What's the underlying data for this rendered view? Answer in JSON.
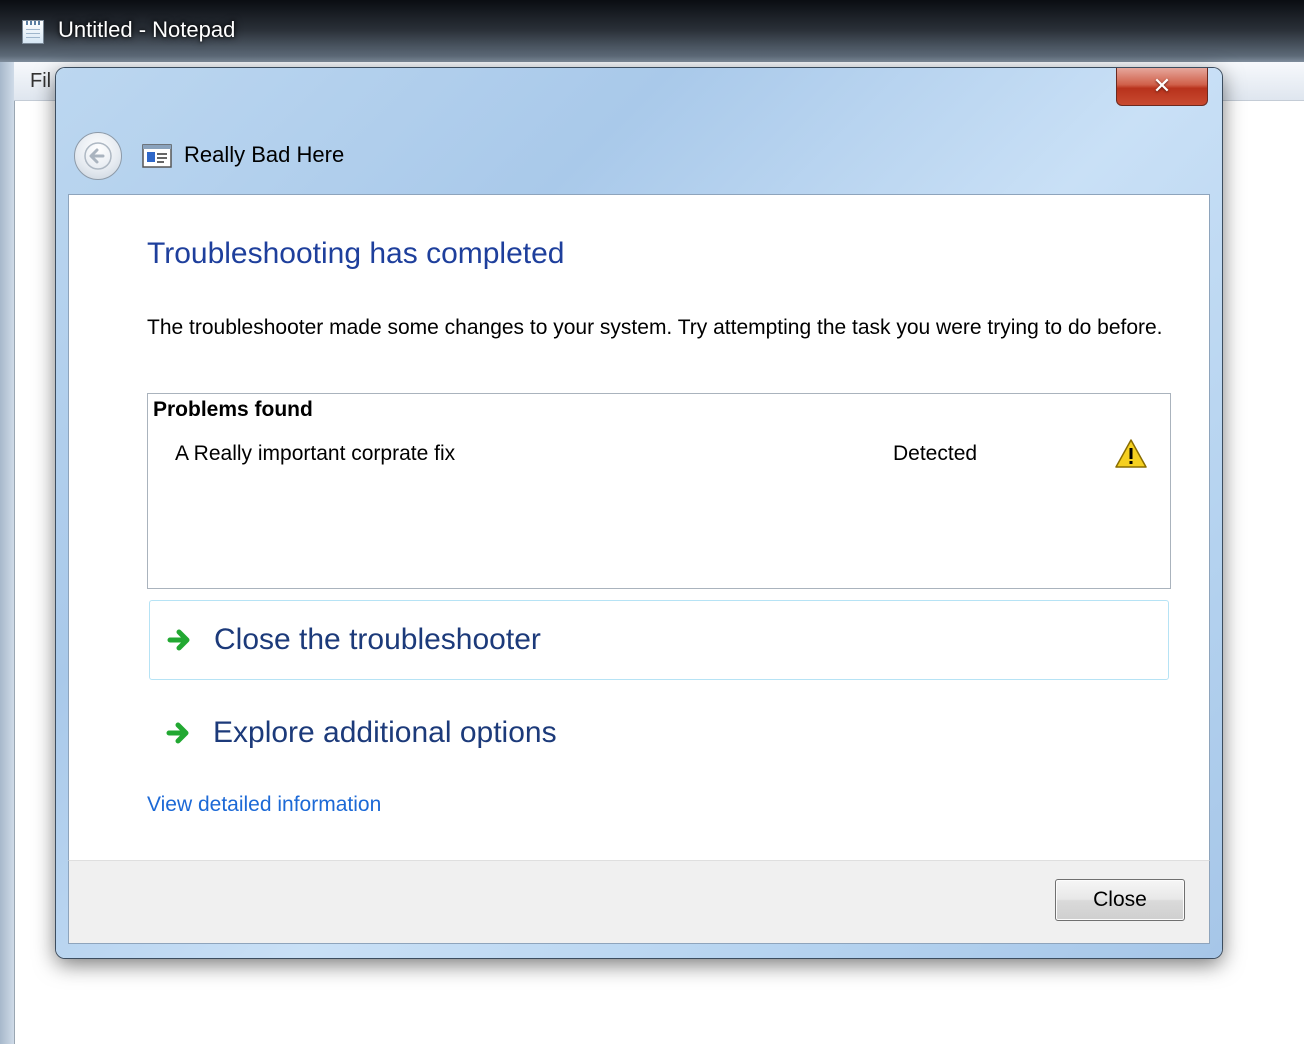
{
  "notepad": {
    "window_title": "Untitled - Notepad",
    "menu_first": "Fil",
    "icon": "notepad-icon"
  },
  "dialog": {
    "app_title": "Really Bad Here",
    "close_glyph": "✕",
    "icons": [
      "back-arrow-icon",
      "troubleshooter-app-icon",
      "close-icon"
    ],
    "heading": "Troubleshooting has completed",
    "description": "The troubleshooter made some changes to your system. Try attempting the task you were trying to do before.",
    "problems": {
      "header": "Problems found",
      "items": [
        {
          "name": "A Really important corprate fix",
          "status": "Detected",
          "icon": "warning-icon"
        }
      ]
    },
    "actions": [
      {
        "label": "Close the troubleshooter",
        "icon": "green-arrow-icon"
      },
      {
        "label": "Explore additional options",
        "icon": "green-arrow-icon"
      }
    ],
    "detail_link": "View detailed information",
    "footer": {
      "close_button": "Close"
    }
  },
  "colors": {
    "heading": "#1e3f9c",
    "link": "#1c69d6",
    "action_text": "#1c3a7a",
    "close_button_red": "#c84a30",
    "warning_yellow": "#f5d020",
    "arrow_green": "#22a832"
  }
}
